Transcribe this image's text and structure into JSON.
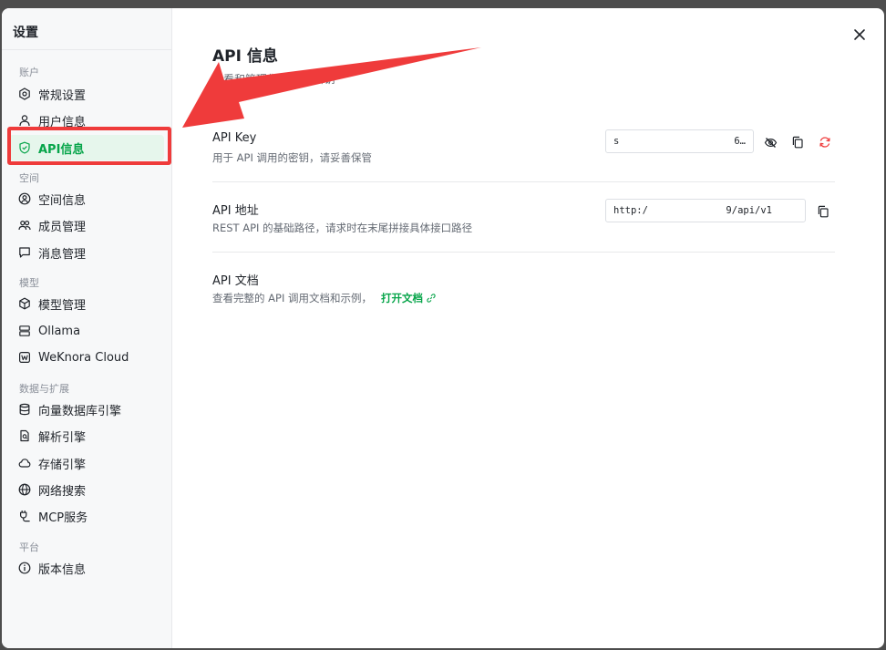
{
  "sidebar": {
    "title": "设置",
    "groups": {
      "account": "账户",
      "space": "空间",
      "model": "模型",
      "data": "数据与扩展",
      "platform": "平台"
    },
    "items": {
      "general": "常规设置",
      "user_info": "用户信息",
      "api_info": "API信息",
      "space_info": "空间信息",
      "members": "成员管理",
      "messages": "消息管理",
      "model_mgmt": "模型管理",
      "ollama": "Ollama",
      "weknora_cloud": "WeKnora Cloud",
      "vector_db": "向量数据库引擎",
      "parser": "解析引擎",
      "storage": "存储引擎",
      "web_search": "网络搜索",
      "mcp": "MCP服务",
      "version": "版本信息"
    }
  },
  "main": {
    "title": "API 信息",
    "subtitle": "查看和管理您的 API 密钥",
    "api_key": {
      "title": "API Key",
      "desc": "用于 API 调用的密钥，请妥善保管",
      "value_start": "s",
      "value_end": "6…"
    },
    "api_url": {
      "title": "API 地址",
      "desc": "REST API 的基础路径，请求时在末尾拼接具体接口路径",
      "value_start": "http:/",
      "value_end": "9/api/v1"
    },
    "api_docs": {
      "title": "API 文档",
      "desc": "查看完整的 API 调用文档和示例，",
      "link": "打开文档"
    }
  },
  "colors": {
    "accent": "#07a54a",
    "annotation": "#ef3b3b"
  }
}
